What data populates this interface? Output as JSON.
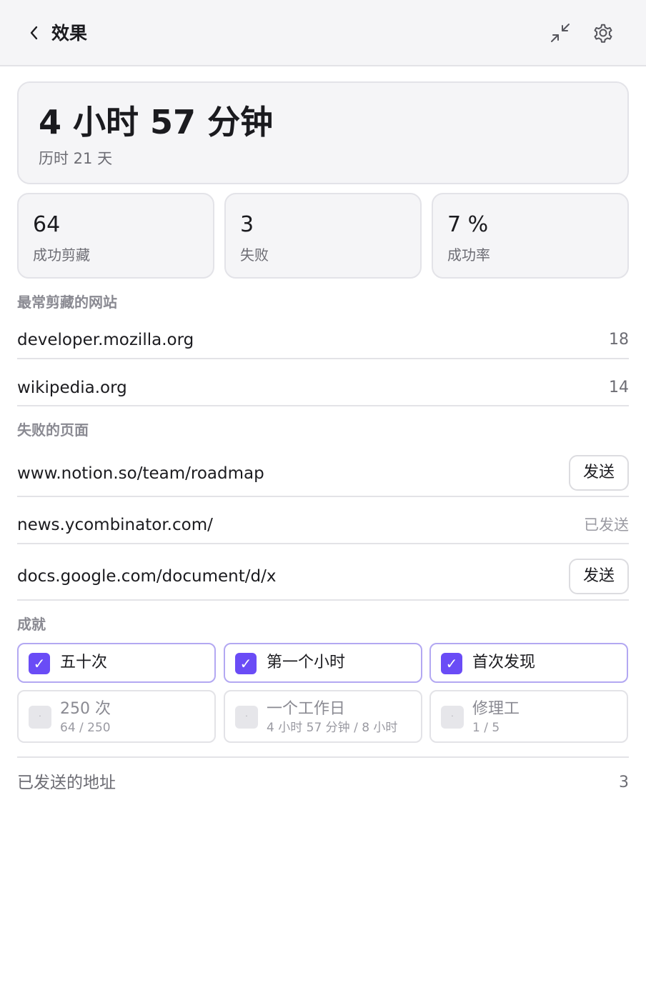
{
  "header": {
    "title": "效果",
    "back_icon": "chevron-left-icon",
    "collapse_icon": "collapse-arrows-icon",
    "settings_icon": "gear-icon"
  },
  "summary": {
    "total_time": "4 小时 57 分钟",
    "period": "历时 21 天"
  },
  "stats": [
    {
      "value": "64",
      "label": "成功剪藏"
    },
    {
      "value": "3",
      "label": "失败"
    },
    {
      "value": "7 %",
      "label": "成功率"
    }
  ],
  "top_sites": {
    "title": "最常剪藏的网站",
    "items": [
      {
        "domain": "developer.mozilla.org",
        "count": "18"
      },
      {
        "domain": "wikipedia.org",
        "count": "14"
      }
    ]
  },
  "failed_pages": {
    "title": "失败的页面",
    "items": [
      {
        "url": "www.notion.so/team/roadmap",
        "action": "发送"
      },
      {
        "url": "news.ycombinator.com/",
        "status": "已发送"
      },
      {
        "url": "docs.google.com/document/d/x",
        "action": "发送"
      }
    ]
  },
  "achievements": {
    "title": "成就",
    "unlocked": [
      {
        "label": "五十次"
      },
      {
        "label": "第一个小时"
      },
      {
        "label": "首次发现"
      }
    ],
    "locked": [
      {
        "label": "250 次",
        "progress": "64 / 250"
      },
      {
        "label": "一个工作日",
        "progress": "4 小时 57 分钟 / 8 小时"
      },
      {
        "label": "修理工",
        "progress": "1 / 5"
      }
    ],
    "check_glyph": "✓",
    "lock_glyph": "·"
  },
  "sent_addresses": {
    "label": "已发送的地址",
    "count": "3"
  },
  "colors": {
    "accent": "#6a4cf6",
    "accent_border": "#b3a8f2",
    "card_bg": "#f5f5f7"
  }
}
